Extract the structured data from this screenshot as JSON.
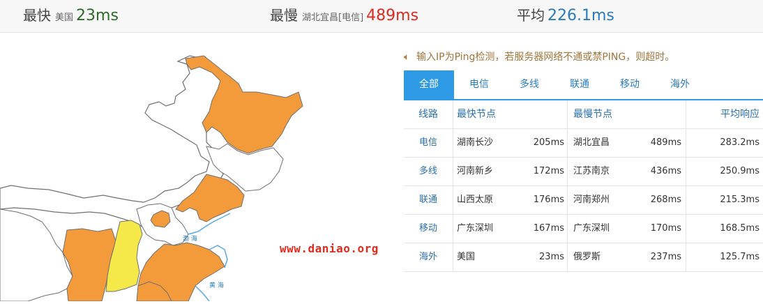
{
  "summary": {
    "fastest": {
      "label": "最快",
      "location": "美国",
      "value": "23ms",
      "color": "#2b6b2b"
    },
    "slowest": {
      "label": "最慢",
      "location": "湖北宜昌[电信]",
      "value": "489ms",
      "color": "#e02a1e"
    },
    "average": {
      "label": "平均",
      "value": "226.1ms",
      "color": "#2a7bbd"
    }
  },
  "map": {
    "sea_label_1": "渤 海",
    "sea_label_2": "黄 海",
    "colors": {
      "orange": "#f39a3b",
      "yellow": "#f5e94a",
      "border": "#6f6f6f",
      "coast": "#5aa8e0"
    }
  },
  "watermark": "www.daniao.org",
  "notice": {
    "icon": "speaker-icon",
    "text": "输入IP为Ping检测，若服务器网络不通或禁PING，则超时。"
  },
  "tabs": [
    "全部",
    "电信",
    "多线",
    "联通",
    "移动",
    "海外"
  ],
  "table": {
    "headers": {
      "line": "线路",
      "fastest": "最快节点",
      "slowest": "最慢节点",
      "average": "平均响应"
    },
    "rows": [
      {
        "line": "电信",
        "fast_node": "湖南长沙",
        "fast_ms": "205ms",
        "slow_node": "湖北宜昌",
        "slow_ms": "489ms",
        "avg": "283.2ms"
      },
      {
        "line": "多线",
        "fast_node": "河南新乡",
        "fast_ms": "172ms",
        "slow_node": "江苏南京",
        "slow_ms": "436ms",
        "avg": "250.9ms"
      },
      {
        "line": "联通",
        "fast_node": "山西太原",
        "fast_ms": "176ms",
        "slow_node": "河南郑州",
        "slow_ms": "268ms",
        "avg": "215.3ms"
      },
      {
        "line": "移动",
        "fast_node": "广东深圳",
        "fast_ms": "167ms",
        "slow_node": "广东深圳",
        "slow_ms": "170ms",
        "avg": "168.5ms"
      },
      {
        "line": "海外",
        "fast_node": "美国",
        "fast_ms": "23ms",
        "slow_node": "俄罗斯",
        "slow_ms": "237ms",
        "avg": "125.7ms"
      }
    ]
  }
}
